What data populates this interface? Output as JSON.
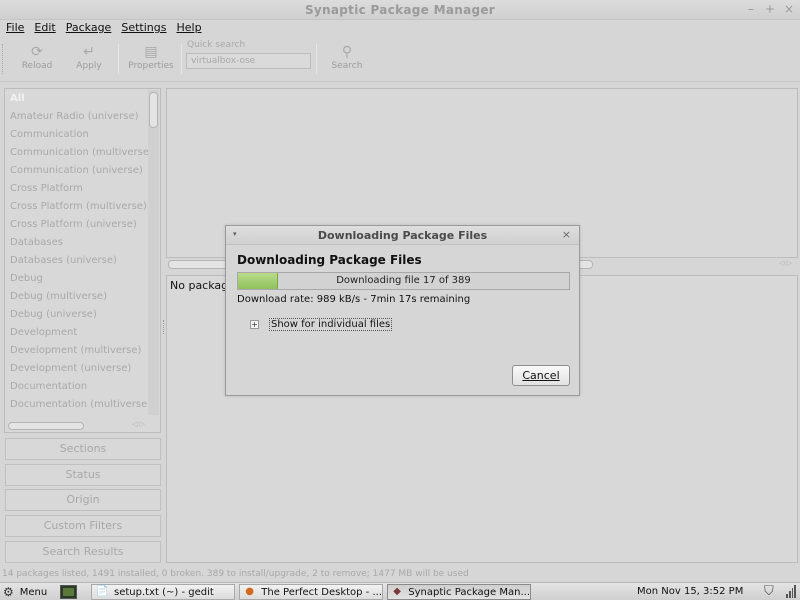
{
  "window": {
    "title": "Synaptic Package Manager",
    "controls": [
      "–",
      "+",
      "×"
    ]
  },
  "menubar": {
    "file": "File",
    "edit": "Edit",
    "package": "Package",
    "settings": "Settings",
    "help": "Help"
  },
  "toolbar": {
    "reload": "Reload",
    "apply": "Apply",
    "properties": "Properties",
    "quick_search_label": "Quick search",
    "quick_search_value": "virtualbox-ose",
    "search": "Search"
  },
  "categories": [
    "All",
    "Amateur Radio (universe)",
    "Communication",
    "Communication (multiverse)",
    "Communication (universe)",
    "Cross Platform",
    "Cross Platform (multiverse)",
    "Cross Platform (universe)",
    "Databases",
    "Databases (universe)",
    "Debug",
    "Debug (multiverse)",
    "Debug (universe)",
    "Development",
    "Development (multiverse)",
    "Development (universe)",
    "Documentation",
    "Documentation (multiverse)"
  ],
  "filter_buttons": {
    "sections": "Sections",
    "status": "Status",
    "origin": "Origin",
    "custom_filters": "Custom Filters",
    "search_results": "Search Results"
  },
  "description": {
    "text": "No package"
  },
  "statusbar": {
    "text": "14 packages listed, 1491 installed, 0 broken. 389 to install/upgrade, 2 to remove; 1477 MB will be used"
  },
  "dialog": {
    "title": "Downloading Package Files",
    "heading": "Downloading Package Files",
    "progress_text": "Downloading file 17 of 389",
    "progress_fraction": 0.12,
    "rate_text": "Download rate: 989 kB/s - 7min 17s remaining",
    "expander_label": "Show for individual files",
    "expander_symbol": "+",
    "cancel": "Cancel",
    "close_symbol": "×",
    "menu_symbol": "▾"
  },
  "taskbar": {
    "menu": "Menu",
    "tasks": [
      "setup.txt (~) - gedit",
      "The Perfect Desktop - ...",
      "Synaptic Package Man..."
    ],
    "clock": "Mon Nov 15,  3:52 PM"
  }
}
